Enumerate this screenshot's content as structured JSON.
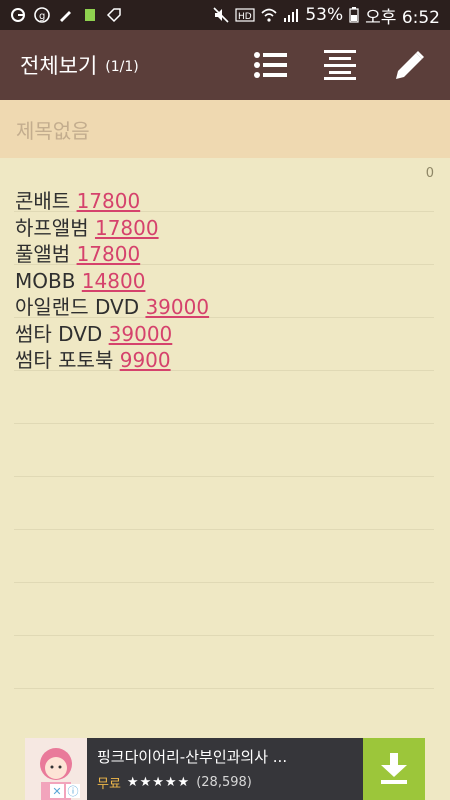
{
  "status_bar": {
    "battery_percent": "53%",
    "time": "오후 6:52",
    "icons": [
      "g-icon",
      "cloud-icon",
      "pen-icon",
      "battery-saver-icon",
      "tag-icon",
      "mute-icon",
      "hd-icon",
      "wifi-icon",
      "signal-icon",
      "battery-icon"
    ]
  },
  "toolbar": {
    "title": "전체보기",
    "count": "(1/1)",
    "actions": [
      "list-icon",
      "align-center-icon",
      "edit-pencil-icon"
    ]
  },
  "title_field": {
    "placeholder": "제목없음"
  },
  "note": {
    "char_count": "0",
    "lines": [
      {
        "label": "콘배트 ",
        "price": "17800"
      },
      {
        "label": "하프앨범 ",
        "price": "17800"
      },
      {
        "label": "풀앨범 ",
        "price": "17800"
      },
      {
        "label": "MOBB ",
        "price": "14800"
      },
      {
        "label": "아일랜드 DVD ",
        "price": "39000"
      },
      {
        "label": "썸타 DVD ",
        "price": "39000"
      },
      {
        "label": "썸타 포토북 ",
        "price": "9900"
      }
    ]
  },
  "ad": {
    "title": "핑크다이어리-산부인과의사 ...",
    "price": "무료",
    "stars": "★★★★★",
    "reviews": "(28,598)"
  },
  "colors": {
    "status_bar": "#2b1f1d",
    "toolbar": "#5b3e3a",
    "title_bar": "#efd9b1",
    "paper": "#efe8c4",
    "price": "#d5426c"
  }
}
